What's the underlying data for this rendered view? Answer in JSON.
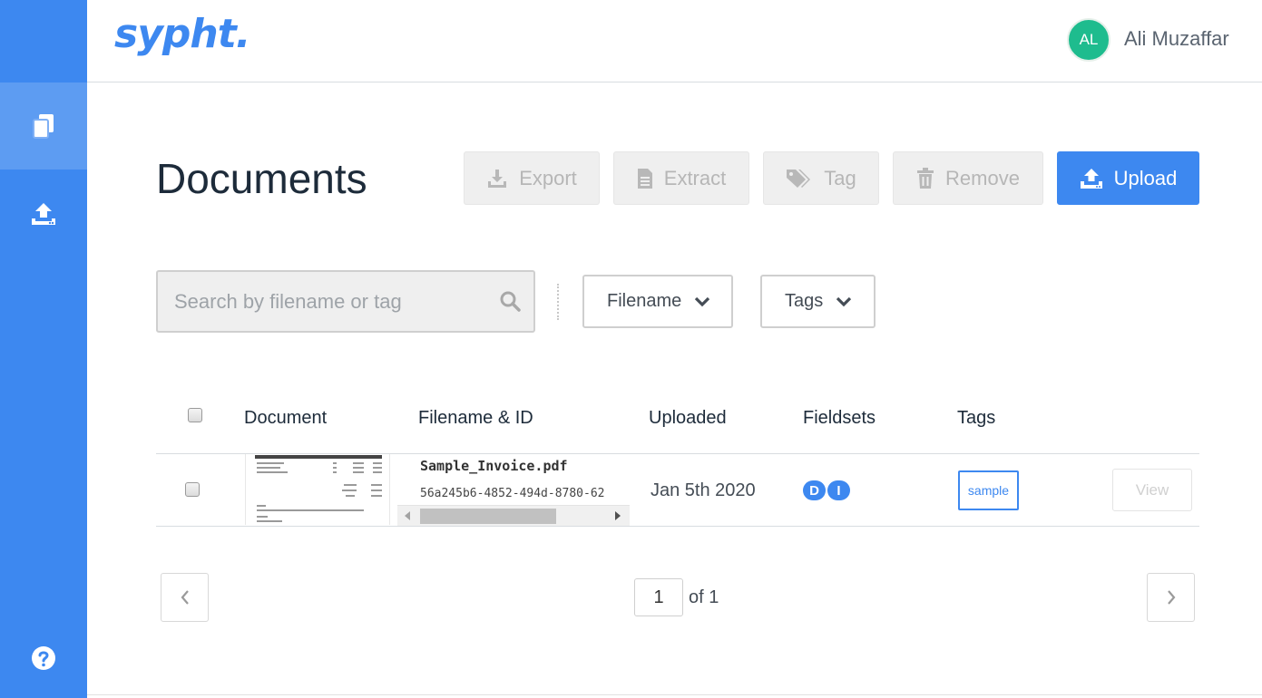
{
  "brand": {
    "logo_text": "sypht.",
    "color": "#3d88f0"
  },
  "user": {
    "initials": "AL",
    "name": "Ali Muzaffar",
    "avatar_color": "#1ebc8e"
  },
  "sidebar": {
    "items": [
      {
        "name": "documents",
        "icon": "documents-icon",
        "active": true
      },
      {
        "name": "upload",
        "icon": "upload-icon",
        "active": false
      },
      {
        "name": "help",
        "icon": "help-icon",
        "active": false
      }
    ]
  },
  "page": {
    "title": "Documents"
  },
  "toolbar": {
    "export_label": "Export",
    "extract_label": "Extract",
    "tag_label": "Tag",
    "remove_label": "Remove",
    "upload_label": "Upload"
  },
  "search": {
    "placeholder": "Search by filename or tag",
    "value": ""
  },
  "filters": {
    "filename_label": "Filename",
    "tags_label": "Tags"
  },
  "table": {
    "headers": {
      "document": "Document",
      "filename": "Filename & ID",
      "uploaded": "Uploaded",
      "fieldsets": "Fieldsets",
      "tags": "Tags"
    },
    "rows": [
      {
        "filename": "Sample_Invoice.pdf",
        "id": "56a245b6-4852-494d-8780-62",
        "uploaded": "Jan 5th 2020",
        "fieldsets": [
          "D",
          "I"
        ],
        "tags": [
          "sample"
        ],
        "view_label": "View"
      }
    ]
  },
  "pagination": {
    "current": "1",
    "of_label": "of 1"
  }
}
